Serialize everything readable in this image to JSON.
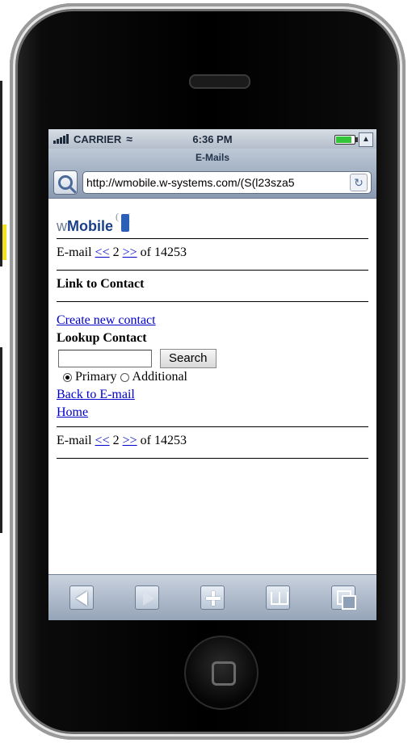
{
  "status": {
    "carrier": "CARRIER",
    "time": "6:36 PM"
  },
  "browser": {
    "title": "E-Mails",
    "url": "http://wmobile.w-systems.com/(S(l23sza5"
  },
  "logo": {
    "w": "w",
    "rest": "Mobile"
  },
  "pager_top": {
    "prefix": "E-mail",
    "prev": "<<",
    "page": "2",
    "next": ">>",
    "suffix": "of 14253"
  },
  "heading": "Link to Contact",
  "links": {
    "create_contact": "Create new contact",
    "back_email": "Back to E-mail",
    "home": "Home"
  },
  "lookup": {
    "label": "Lookup Contact",
    "search_button": "Search",
    "input_value": "",
    "radio_primary": "Primary",
    "radio_additional": "Additional",
    "selected": "Primary"
  },
  "pager_bottom": {
    "prefix": "E-mail",
    "prev": "<<",
    "page": "2",
    "next": ">>",
    "suffix": "of 14253"
  },
  "toolbar": {
    "back_icon": "back-arrow-icon",
    "forward_icon": "forward-arrow-icon",
    "add_icon": "plus-icon",
    "bookmarks_icon": "bookmarks-icon",
    "pages_icon": "pages-icon"
  }
}
